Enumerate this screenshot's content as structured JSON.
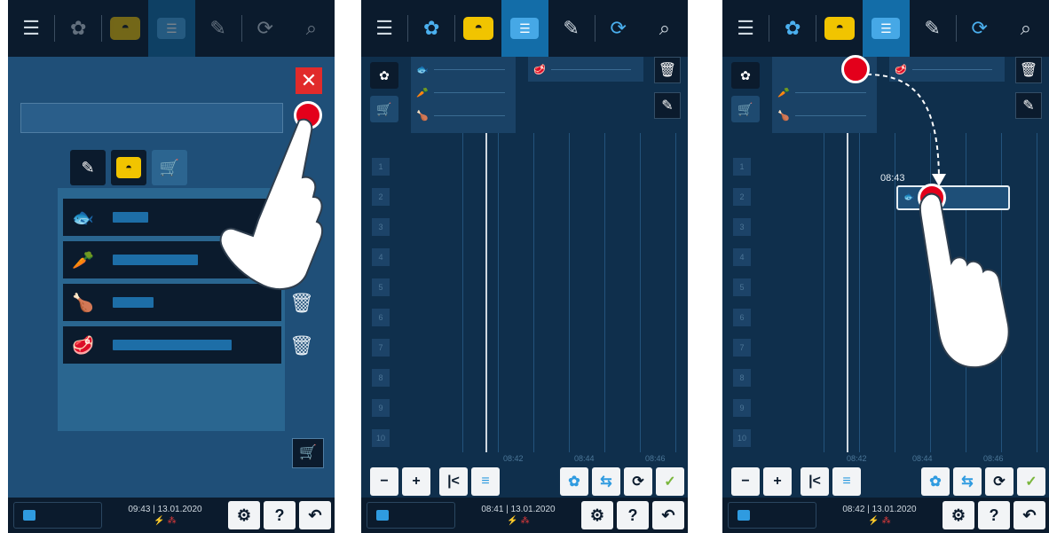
{
  "panels": [
    {
      "topbar": {
        "menu_icon": "menu-icon",
        "tab_icons": [
          "intelligent-cooking-icon",
          "cooking-paths-icon",
          "planning-icon",
          "programming-icon",
          "service-icon",
          "search-icon"
        ],
        "active": "planning"
      },
      "dialog": {
        "close_label": "✕",
        "name_placeholder": "",
        "tabs": [
          "programs-tab-icon",
          "cooking-paths-tab-icon",
          "shopping-cart-tab-icon"
        ],
        "items": [
          {
            "icon": "fish-icon"
          },
          {
            "icon": "vegetables-icon"
          },
          {
            "icon": "poultry-icon"
          },
          {
            "icon": "meat-icon"
          }
        ]
      },
      "bottom": {
        "time": "09:43",
        "date": "13.01.2020"
      }
    },
    {
      "bottom": {
        "time": "08:41",
        "date": "13.01.2020"
      },
      "ticks": [
        "08:42",
        "08:44",
        "08:46"
      ],
      "slots": [
        "1",
        "2",
        "3",
        "4",
        "5",
        "6",
        "7",
        "8",
        "9",
        "10"
      ]
    },
    {
      "bottom": {
        "time": "08:42",
        "date": "13.01.2020"
      },
      "ticks": [
        "08:42",
        "08:44",
        "08:46"
      ],
      "slots": [
        "1",
        "2",
        "3",
        "4",
        "5",
        "6",
        "7",
        "8",
        "9",
        "10"
      ],
      "drag_time": "08:43"
    }
  ],
  "common": {
    "settings_label": "⚙",
    "help_label": "?",
    "back_label": "↶",
    "zoom_out": "−",
    "zoom_in": "+",
    "jump_label": "|<"
  },
  "colors": {
    "background": "#0f2f4c",
    "bar": "#0b1b2d",
    "accent_blue": "#2f9be0",
    "active_tab": "#136da8",
    "yellow": "#f1c400",
    "red": "#e3001b"
  }
}
